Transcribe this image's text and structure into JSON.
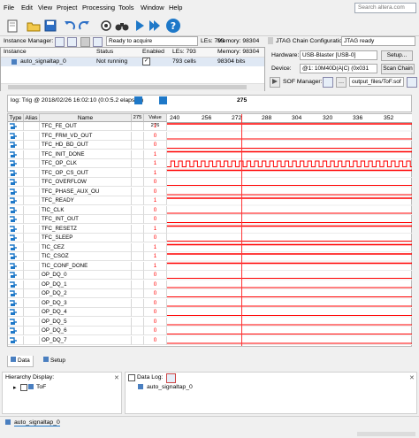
{
  "menu": [
    "File",
    "Edit",
    "View",
    "Project",
    "Processing",
    "Tools",
    "Window",
    "Help"
  ],
  "search": {
    "placeholder": "Search altera.com"
  },
  "instance_manager": {
    "label": "Instance Manager:",
    "status_text": "Ready to acquire",
    "les": "LEs: 793",
    "memory": "Memory: 98304",
    "columns": [
      "Instance",
      "Status",
      "Enabled",
      "LEs: 793",
      "Memory: 98304"
    ],
    "row": {
      "instance": "auto_signaltap_0",
      "status": "Not running",
      "enabled": "✓",
      "les": "793 cells",
      "memory": "98304 bits"
    }
  },
  "jtag": {
    "label": "JTAG Chain Configuration:",
    "status": "JTAG ready",
    "hardware_label": "Hardware:",
    "hardware_value": "USB-Blaster [USB-0]",
    "setup_label": "Setup...",
    "device_label": "Device:",
    "device_value": "@1: 10M40D(A|C) (0x031",
    "scan_chain_label": "Scan Chain",
    "sof_label": "SOF Manager:",
    "sof_path": "output_files/ToF.sof"
  },
  "log": {
    "text": "log: Trig @ 2018/02/26 16:02:10 (0:0:5.2 elapsed)",
    "marker": "275",
    "columns": [
      "Type",
      "Alias",
      "Name",
      "275",
      "Value 276"
    ],
    "ticks": [
      "240",
      "256",
      "272",
      "288",
      "304",
      "320",
      "336",
      "352"
    ]
  },
  "signals": [
    {
      "name": "TFC_FE_OUT",
      "value": "1",
      "type": "const1"
    },
    {
      "name": "TFC_FRM_VD_OUT",
      "value": "0",
      "type": "const0"
    },
    {
      "name": "TFC_HD_BD_OUT",
      "value": "0",
      "type": "const0"
    },
    {
      "name": "TFC_INIT_DONE",
      "value": "1",
      "type": "const1"
    },
    {
      "name": "TFC_OP_CLK",
      "value": "1",
      "type": "clock"
    },
    {
      "name": "TFC_OP_CS_OUT",
      "value": "1",
      "type": "const1"
    },
    {
      "name": "TFC_OVERFLOW",
      "value": "0",
      "type": "const0"
    },
    {
      "name": "TFC_PHASE_AUX_OU",
      "value": "0",
      "type": "const0"
    },
    {
      "name": "TFC_READY",
      "value": "1",
      "type": "const1"
    },
    {
      "name": "TIC_CLK",
      "value": "0",
      "type": "const0"
    },
    {
      "name": "TFC_INT_OUT",
      "value": "0",
      "type": "const0"
    },
    {
      "name": "TFC_RESETZ",
      "value": "1",
      "type": "const1"
    },
    {
      "name": "TFC_SLEEP",
      "value": "0",
      "type": "const0"
    },
    {
      "name": "TIC_CEZ",
      "value": "1",
      "type": "const1"
    },
    {
      "name": "TIC_CSOZ",
      "value": "1",
      "type": "const1"
    },
    {
      "name": "TIC_CONF_DONE",
      "value": "1",
      "type": "const1"
    },
    {
      "name": "OP_DQ_0",
      "value": "0",
      "type": "const0"
    },
    {
      "name": "OP_DQ_1",
      "value": "0",
      "type": "const0"
    },
    {
      "name": "OP_DQ_2",
      "value": "0",
      "type": "const0"
    },
    {
      "name": "OP_DQ_3",
      "value": "0",
      "type": "const0"
    },
    {
      "name": "OP_DQ_4",
      "value": "0",
      "type": "const0"
    },
    {
      "name": "OP_DQ_5",
      "value": "0",
      "type": "const0"
    },
    {
      "name": "OP_DQ_6",
      "value": "0",
      "type": "const0"
    },
    {
      "name": "OP_DQ_7",
      "value": "0",
      "type": "const0"
    }
  ],
  "tabs": {
    "data": "Data",
    "setup": "Setup"
  },
  "hierarchy": {
    "label": "Hierarchy Display:",
    "item": "ToF"
  },
  "data_log": {
    "label": "Data Log:",
    "item": "auto_signaltap_0"
  },
  "bottom_instance": "auto_signaltap_0",
  "colors": {
    "wave": "#ff0000",
    "accent": "#1e78c8"
  }
}
